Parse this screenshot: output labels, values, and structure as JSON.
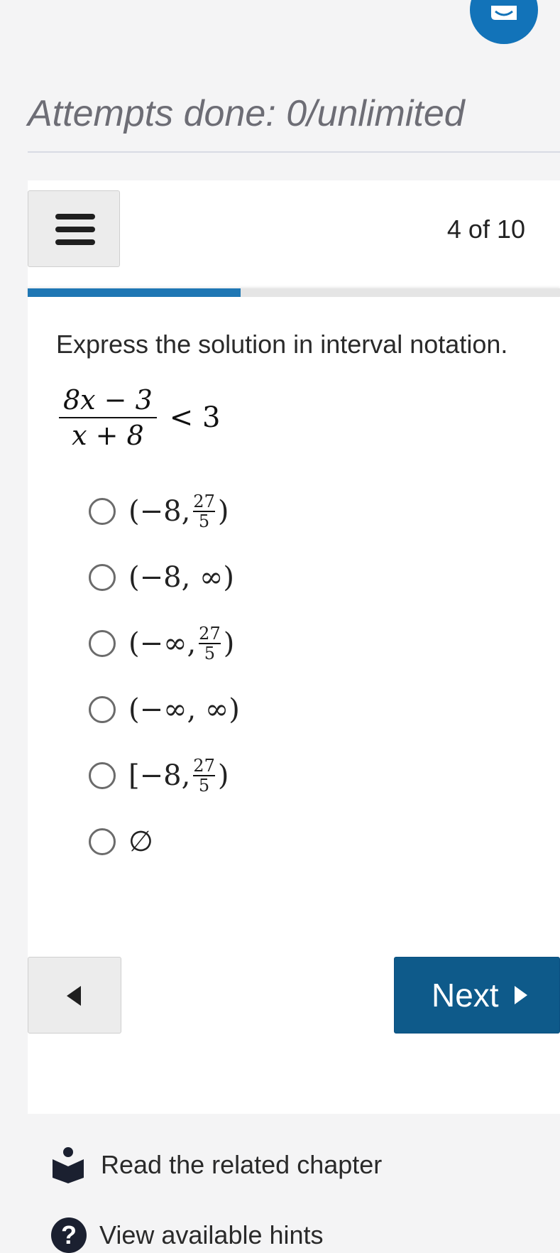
{
  "header": {
    "attempts_text": "Attempts done: 0/unlimited"
  },
  "quiz": {
    "counter": "4 of 10",
    "progress": {
      "current": 4,
      "total": 10
    },
    "prompt": "Express the solution in interval notation.",
    "inequality": {
      "numerator": "8x − 3",
      "denominator": "x + 8",
      "rest": "< 3"
    },
    "options": [
      {
        "open": "(",
        "left": "−8",
        "right_num": "27",
        "right_den": "5",
        "close": ")"
      },
      {
        "open": "(",
        "left": "−8",
        "right": "∞",
        "close": ")"
      },
      {
        "open": "(",
        "left": "−∞",
        "right_num": "27",
        "right_den": "5",
        "close": ")"
      },
      {
        "open": "(",
        "left": "−∞",
        "right": "∞",
        "close": ")"
      },
      {
        "open": "[",
        "left": "−8",
        "right_num": "27",
        "right_den": "5",
        "close": ")"
      },
      {
        "symbol": "∅"
      }
    ],
    "next_label": "Next"
  },
  "footer": {
    "related_label": "Read the related chapter",
    "hints_label": "View available hints"
  },
  "colors": {
    "accent": "#1f77b4",
    "next_button": "#0e5a8a",
    "fab": "#1273b9"
  }
}
